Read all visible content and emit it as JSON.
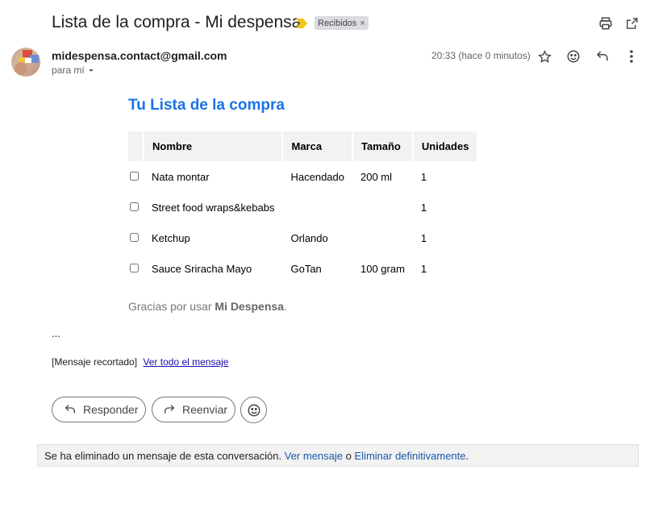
{
  "subject": "Lista de la compra - Mi despensa",
  "label": "Recibidos",
  "sender": {
    "email": "midespensa.contact@gmail.com",
    "recipient": "para mí",
    "time": "20:33 (hace 0 minutos)"
  },
  "email_body": {
    "title": "Tu Lista de la compra",
    "columns": [
      "Nombre",
      "Marca",
      "Tamaño",
      "Unidades"
    ],
    "rows": [
      {
        "nombre": "Nata montar",
        "marca": "Hacendado",
        "tamano": "200 ml",
        "unidades": "1"
      },
      {
        "nombre": "Street food wraps&kebabs",
        "marca": "",
        "tamano": "",
        "unidades": "1"
      },
      {
        "nombre": "Ketchup",
        "marca": "Orlando",
        "tamano": "",
        "unidades": "1"
      },
      {
        "nombre": "Sauce Sriracha Mayo",
        "marca": "GoTan",
        "tamano": "100 gram",
        "unidades": "1"
      }
    ],
    "thanks_prefix": "Gracias por usar ",
    "thanks_brand": "Mi Despensa",
    "thanks_suffix": "."
  },
  "ellipsis": "...",
  "clipped": {
    "text": "[Mensaje recortado]",
    "link": "Ver todo el mensaje"
  },
  "actions": {
    "reply": "Responder",
    "forward": "Reenviar"
  },
  "deleted_notice": {
    "text": "Se ha eliminado un mensaje de esta conversación.",
    "view_link": "Ver mensaje",
    "or": "o",
    "delete_link": "Eliminar definitivamente",
    "end": "."
  },
  "colors": {
    "title_blue": "#1a73e8",
    "link_blue": "#1a57a8",
    "importance_marker": "#f5c518"
  },
  "icons": [
    "importance-marker-icon",
    "print-icon",
    "open-new-window-icon",
    "star-icon",
    "emoji-icon",
    "reply-icon",
    "more-vert-icon",
    "chevron-down-icon",
    "forward-icon"
  ]
}
